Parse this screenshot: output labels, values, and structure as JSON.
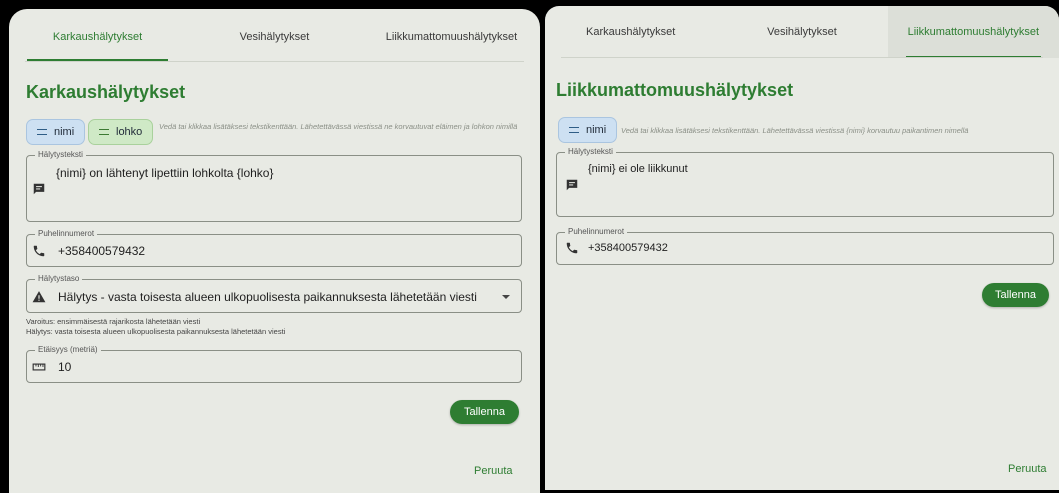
{
  "colors": {
    "accent": "#2e7d32",
    "panel_bg": "#e8eae4",
    "chip_blue": "#cde0f2",
    "chip_green": "#cfe9c6"
  },
  "left": {
    "tabs": [
      {
        "label": "Karkaushälytykset"
      },
      {
        "label": "Vesihälytykset"
      },
      {
        "label": "Liikkumattomuushälytykset"
      }
    ],
    "title": "Karkaushälytykset",
    "chips": [
      {
        "label": "nimi"
      },
      {
        "label": "lohko"
      }
    ],
    "hint": "Vedä tai klikkaa lisätäksesi tekstikenttään. Lähetettävässä viestissä ne korvautuvat eläimen ja lohkon nimillä",
    "alert_text": {
      "label": "Hälytysteksti",
      "value": "{nimi} on lähtenyt lipettiin lohkolta {lohko}",
      "icon": "message-icon"
    },
    "phone": {
      "label": "Puhelinnumerot",
      "value": "+358400579432",
      "icon": "phone-icon"
    },
    "level": {
      "label": "Hälytystaso",
      "value": "Hälytys - vasta toisesta alueen ulkopuolisesta paikannuksesta lähetetään viesti",
      "icon": "warning-icon",
      "helper_1": "Varoitus: ensimmäisestä rajarikosta lähetetään viesti",
      "helper_2": "Hälytys: vasta toisesta alueen ulkopuolisesta paikannuksesta lähetetään viesti"
    },
    "distance": {
      "label": "Etäisyys (metriä)",
      "value": "10",
      "icon": "ruler-icon"
    },
    "save_label": "Tallenna",
    "cancel_label": "Peruuta"
  },
  "right": {
    "tabs": [
      {
        "label": "Karkaushälytykset"
      },
      {
        "label": "Vesihälytykset"
      },
      {
        "label": "Liikkumattomuushälytykset"
      }
    ],
    "title": "Liikkumattomuushälytykset",
    "chips": [
      {
        "label": "nimi"
      }
    ],
    "hint": "Vedä tai klikkaa lisätäksesi tekstikenttään. Lähetettävässä viestissä {nimi} korvautuu paikantimen nimellä",
    "alert_text": {
      "label": "Hälytysteksti",
      "value": "{nimi} ei ole liikkunut",
      "icon": "message-icon"
    },
    "phone": {
      "label": "Puhelinnumerot",
      "value": "+358400579432",
      "icon": "phone-icon"
    },
    "save_label": "Tallenna",
    "cancel_label": "Peruuta"
  }
}
